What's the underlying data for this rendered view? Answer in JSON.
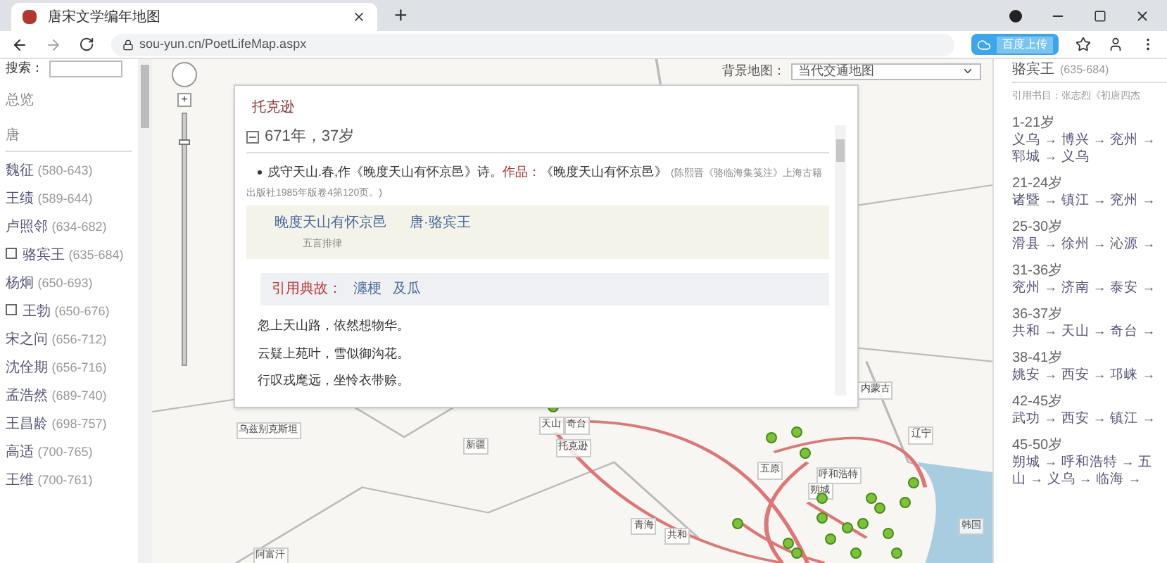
{
  "browser": {
    "tab_title": "唐宋文学编年地图",
    "new_tab": "+",
    "url": "sou-yun.cn/PoetLifeMap.aspx",
    "extension": "百度上传"
  },
  "sidebar": {
    "search_label": "搜索：",
    "overview": "总览",
    "dynasty": "唐",
    "items": [
      {
        "kind": "plain",
        "name": "魏征",
        "years": "(580-643)"
      },
      {
        "kind": "plain",
        "name": "王绩",
        "years": "(589-644)"
      },
      {
        "kind": "plain",
        "name": "卢照邻",
        "years": "(634-682)"
      },
      {
        "kind": "checkbox",
        "checked": false,
        "name": "骆宾王",
        "years": "(635-684)"
      },
      {
        "kind": "plain",
        "name": "杨炯",
        "years": "(650-693)"
      },
      {
        "kind": "checkbox",
        "checked": false,
        "name": "王勃",
        "years": "(650-676)"
      },
      {
        "kind": "plain",
        "name": "宋之问",
        "years": "(656-712)"
      },
      {
        "kind": "plain",
        "name": "沈佺期",
        "years": "(656-716)"
      },
      {
        "kind": "plain",
        "name": "孟浩然",
        "years": "(689-740)"
      },
      {
        "kind": "plain",
        "name": "王昌龄",
        "years": "(698-757)"
      },
      {
        "kind": "plain",
        "name": "高适",
        "years": "(700-765)"
      },
      {
        "kind": "plain",
        "name": "王维",
        "years": "(700-761)"
      }
    ]
  },
  "map": {
    "background_label": "背景地图：",
    "background_value": "当代交通地图",
    "zoom_in": "+",
    "zoom_slider": {
      "level": 0.9
    },
    "labels": [
      "天山",
      "奇台",
      "托克逊",
      "新疆",
      "乌兹别克斯坦",
      "阿富汗",
      "青海",
      "内蒙古",
      "辽宁",
      "韩国",
      "五原",
      "呼和浩特",
      "朔城",
      "共和"
    ]
  },
  "popup": {
    "title": "托克逊",
    "section": {
      "expanded": true,
      "heading": "671年，37岁"
    },
    "event": "戍守天山.春,作《晚度天山有怀京邑》诗。",
    "works_label": "作品：",
    "work_title": "《晚度天山有怀京邑》",
    "source": "(陈熙晋《骆临海集笺注》上海古籍出版社1985年版卷4第120页。)",
    "poem_title": "晚度天山有怀京邑",
    "poem_author": "唐·骆宾王",
    "poem_form": "五言排律",
    "allusion_label": "引用典故：",
    "allusions": [
      "瀍梗",
      "及瓜"
    ],
    "lines": [
      "忽上天山路，依然想物华。",
      "云疑上苑叶，雪似御沟花。",
      "行叹戎麾远，坐怜衣带赊。"
    ]
  },
  "panel": {
    "poet": "骆宾王",
    "years": "(635-684)",
    "reference": "引用书目：张志烈《初唐四杰",
    "periods": [
      {
        "age": "1-21岁",
        "route": [
          "义乌 → 博兴 → 兖州 →",
          "郓城 → 义乌"
        ]
      },
      {
        "age": "21-24岁",
        "route": [
          "诸暨 → 镇江 → 兖州 →"
        ]
      },
      {
        "age": "25-30岁",
        "route": [
          "滑县 → 徐州 → 沁源 →"
        ]
      },
      {
        "age": "31-36岁",
        "route": [
          "兖州 → 济南 → 泰安 →"
        ]
      },
      {
        "age": "36-37岁",
        "route": [
          "共和 → 天山 → 奇台 →"
        ]
      },
      {
        "age": "38-41岁",
        "route": [
          "姚安 → 西安 → 邛崃 →"
        ]
      },
      {
        "age": "42-45岁",
        "route": [
          "武功 → 西安 → 镇江 →"
        ]
      },
      {
        "age": "45-50岁",
        "route": [
          "朔城 → 呼和浩特 → 五",
          "山 → 义乌 → 临海 →"
        ]
      }
    ]
  }
}
